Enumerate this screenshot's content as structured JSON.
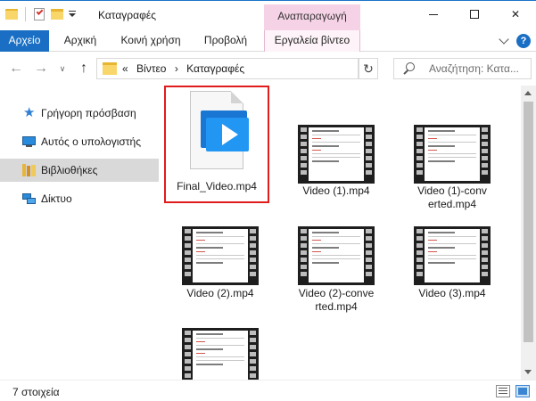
{
  "window": {
    "title": "Καταγραφές",
    "context_tab_group": "Αναπαραγωγή",
    "minimize_label": "",
    "maximize_label": "",
    "close_label": "✕"
  },
  "ribbon": {
    "tabs": [
      {
        "label": "Αρχείο"
      },
      {
        "label": "Αρχική"
      },
      {
        "label": "Κοινή χρήση"
      },
      {
        "label": "Προβολή"
      },
      {
        "label": "Εργαλεία βίντεο"
      }
    ],
    "help_label": "?"
  },
  "navigation": {
    "back_glyph": "←",
    "forward_glyph": "→",
    "recent_glyph": "∨",
    "up_glyph": "↑",
    "breadcrumb": [
      "«",
      "Βίντεο",
      "›",
      "Καταγραφές"
    ],
    "refresh_glyph": "↻",
    "search_placeholder": "Αναζήτηση: Κατα..."
  },
  "sidebar": {
    "items": [
      {
        "label": "Γρήγορη πρόσβαση",
        "icon": "star-icon"
      },
      {
        "label": "Αυτός ο υπολογιστής",
        "icon": "computer-icon"
      },
      {
        "label": "Βιβλιοθήκες",
        "icon": "libraries-icon",
        "selected": true
      },
      {
        "label": "Δίκτυο",
        "icon": "network-icon"
      }
    ]
  },
  "files": [
    {
      "name": "Final_Video.mp4",
      "icon": "video-file-icon",
      "selected": true
    },
    {
      "name": "Video (1).mp4",
      "icon": "video-thumbnail"
    },
    {
      "name": "Video (1)-converted.mp4",
      "icon": "video-thumbnail"
    },
    {
      "name": "Video (2).mp4",
      "icon": "video-thumbnail"
    },
    {
      "name": "Video (2)-converted.mp4",
      "icon": "video-thumbnail"
    },
    {
      "name": "Video (3).mp4",
      "icon": "video-thumbnail"
    },
    {
      "name": "",
      "icon": "video-thumbnail"
    }
  ],
  "status": {
    "item_count": "7 στοιχεία"
  },
  "colors": {
    "accent": "#1a6fc4",
    "context_tab": "#f6d2e6",
    "selection_outline": "#e01c1c",
    "sidebar_selected": "#d9d9d9"
  }
}
